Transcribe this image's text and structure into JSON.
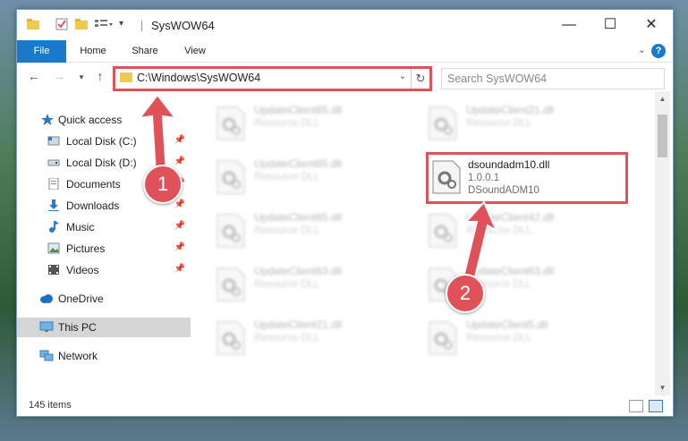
{
  "window": {
    "title": "SysWOW64",
    "controls": {
      "minimize": "—",
      "maximize": "☐",
      "close": "✕"
    }
  },
  "ribbon": {
    "tabs": [
      "File",
      "Home",
      "Share",
      "View"
    ],
    "help": "?"
  },
  "address": {
    "path": "C:\\Windows\\SysWOW64",
    "search_placeholder": "Search SysWOW64"
  },
  "nav_pane": {
    "items": [
      {
        "label": "Quick access",
        "icon": "star-icon",
        "pinned": false
      },
      {
        "label": "Local Disk (C:)",
        "icon": "drive-icon",
        "pinned": true
      },
      {
        "label": "Local Disk (D:)",
        "icon": "drive-icon",
        "pinned": true
      },
      {
        "label": "Documents",
        "icon": "documents-icon",
        "pinned": true
      },
      {
        "label": "Downloads",
        "icon": "download-icon",
        "pinned": true
      },
      {
        "label": "Music",
        "icon": "music-icon",
        "pinned": true
      },
      {
        "label": "Pictures",
        "icon": "pictures-icon",
        "pinned": true
      },
      {
        "label": "Videos",
        "icon": "videos-icon",
        "pinned": true
      },
      {
        "label": "OneDrive",
        "icon": "cloud-icon",
        "pinned": false
      },
      {
        "label": "This PC",
        "icon": "computer-icon",
        "pinned": false,
        "selected": true
      },
      {
        "label": "Network",
        "icon": "network-icon",
        "pinned": false
      }
    ]
  },
  "files": {
    "left_column": [
      {
        "name": "UpdateClient65.dll",
        "sub": "Resource DLL"
      },
      {
        "name": "UpdateClient65.dll",
        "sub": "Resource DLL"
      },
      {
        "name": "UpdateClient65.dll",
        "sub": "Resource DLL"
      },
      {
        "name": "UpdateClient63.dll",
        "sub": "Resource DLL"
      },
      {
        "name": "UpdateClient21.dll",
        "sub": "Resource DLL"
      }
    ],
    "right_column": [
      {
        "name": "UpdateClient21.dll",
        "sub": "Resource DLL"
      },
      {
        "name": "dsoundadm10.dll",
        "sub": "1.0.0.1",
        "sub2": "DSoundADM10",
        "highlighted": true
      },
      {
        "name": "UpdateClient42.dll",
        "sub": "Resource DLL"
      },
      {
        "name": "UpdateClient63.dll",
        "sub": "Resource DLL"
      },
      {
        "name": "UpdateClient5.dll",
        "sub": "Resource DLL"
      }
    ]
  },
  "status": {
    "item_count": "145 items"
  },
  "annotations": {
    "step1": "1",
    "step2": "2"
  },
  "colors": {
    "accent": "#1979ca",
    "highlight": "#e0525a"
  }
}
